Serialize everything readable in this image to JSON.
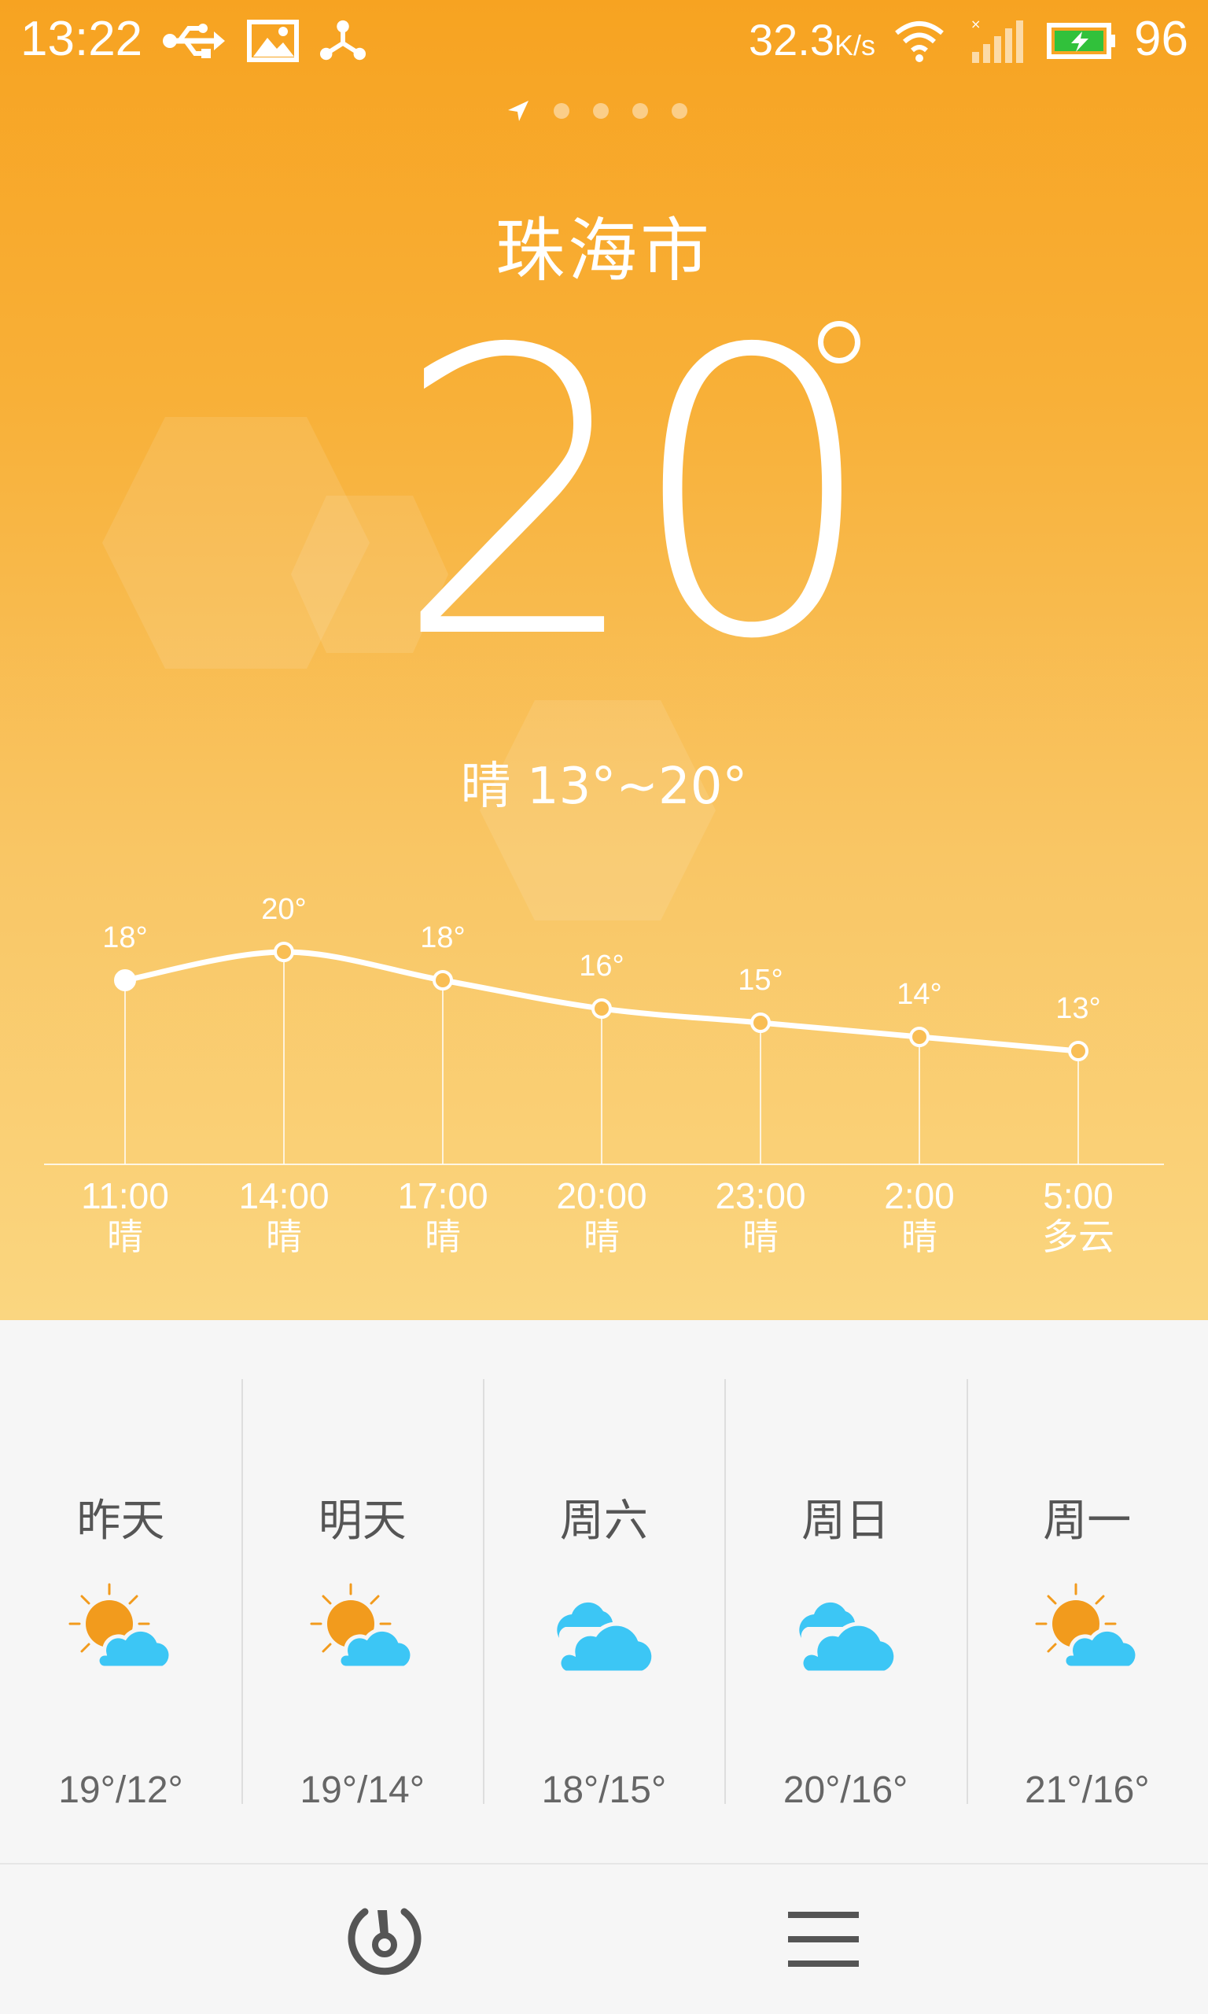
{
  "status_bar": {
    "time": "13:22",
    "net_speed": "32.3",
    "net_unit": "K/s",
    "battery": "96",
    "icons": [
      "usb-icon",
      "image-icon",
      "share-icon",
      "wifi-icon",
      "signal-icon",
      "battery-icon"
    ]
  },
  "location": {
    "city": "珠海市",
    "pager": [
      "location-arrow-icon",
      "dot",
      "dot",
      "dot",
      "dot"
    ]
  },
  "current": {
    "temp": "20",
    "summary": "晴 13°~20°"
  },
  "hourly": {
    "labels_temp": [
      "18°",
      "20°",
      "18°",
      "16°",
      "15°",
      "14°",
      "13°"
    ],
    "times": [
      "11:00",
      "14:00",
      "17:00",
      "20:00",
      "23:00",
      "2:00",
      "5:00"
    ],
    "conditions": [
      "晴",
      "晴",
      "晴",
      "晴",
      "晴",
      "晴",
      "多云"
    ]
  },
  "chart_data": {
    "type": "line",
    "title": "",
    "xlabel": "",
    "ylabel": "",
    "categories": [
      "11:00",
      "14:00",
      "17:00",
      "20:00",
      "23:00",
      "2:00",
      "5:00"
    ],
    "series": [
      {
        "values": [
          18,
          20,
          18,
          16,
          15,
          14,
          13
        ]
      }
    ],
    "ylim": [
      13,
      20
    ],
    "grid": false
  },
  "forecast": {
    "days": [
      {
        "day": "昨天",
        "range": "19°/12°",
        "icon": "sun-cloud-icon"
      },
      {
        "day": "明天",
        "range": "19°/14°",
        "icon": "sun-cloud-icon"
      },
      {
        "day": "周六",
        "range": "18°/15°",
        "icon": "cloud-icon"
      },
      {
        "day": "周日",
        "range": "20°/16°",
        "icon": "cloud-icon"
      },
      {
        "day": "周一",
        "range": "21°/16°",
        "icon": "sun-cloud-icon"
      }
    ]
  },
  "nav": {
    "buttons": [
      "gauge-icon",
      "menu-icon"
    ]
  },
  "colors": {
    "hero_top": "#f7a321",
    "hero_bottom": "#fad680",
    "cloud": "#3cc6f5",
    "sun": "#f29b1d",
    "panel_bg": "#f6f6f6"
  }
}
